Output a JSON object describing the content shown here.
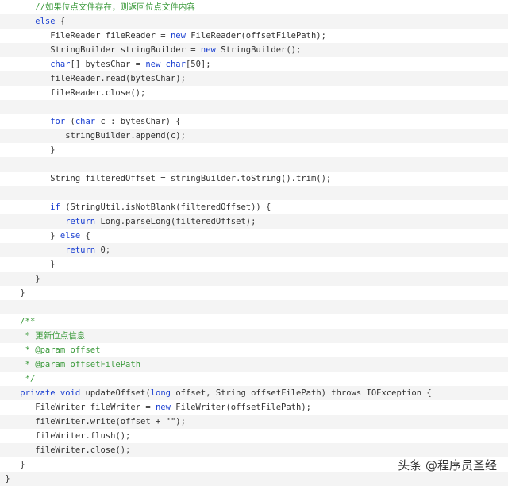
{
  "code": {
    "lines": [
      {
        "indent": 7,
        "tokens": [
          {
            "t": "cm",
            "v": "//如果位点文件存在，则返回位点文件内容"
          }
        ]
      },
      {
        "indent": 7,
        "tokens": [
          {
            "t": "kw",
            "v": "else"
          },
          {
            "t": "tx",
            "v": " {"
          }
        ]
      },
      {
        "indent": 10,
        "tokens": [
          {
            "t": "tx",
            "v": "FileReader fileReader = "
          },
          {
            "t": "kw",
            "v": "new"
          },
          {
            "t": "tx",
            "v": " FileReader(offsetFilePath);"
          }
        ]
      },
      {
        "indent": 10,
        "tokens": [
          {
            "t": "tx",
            "v": "StringBuilder stringBuilder = "
          },
          {
            "t": "kw",
            "v": "new"
          },
          {
            "t": "tx",
            "v": " StringBuilder();"
          }
        ]
      },
      {
        "indent": 10,
        "tokens": [
          {
            "t": "kw",
            "v": "char"
          },
          {
            "t": "tx",
            "v": "[] bytesChar = "
          },
          {
            "t": "kw",
            "v": "new"
          },
          {
            "t": "tx",
            "v": " "
          },
          {
            "t": "kw",
            "v": "char"
          },
          {
            "t": "tx",
            "v": "[50];"
          }
        ]
      },
      {
        "indent": 10,
        "tokens": [
          {
            "t": "tx",
            "v": "fileReader.read(bytesChar);"
          }
        ]
      },
      {
        "indent": 10,
        "tokens": [
          {
            "t": "tx",
            "v": "fileReader.close();"
          }
        ]
      },
      {
        "indent": 0,
        "tokens": []
      },
      {
        "indent": 10,
        "tokens": [
          {
            "t": "kw",
            "v": "for"
          },
          {
            "t": "tx",
            "v": " ("
          },
          {
            "t": "kw",
            "v": "char"
          },
          {
            "t": "tx",
            "v": " c : bytesChar) {"
          }
        ]
      },
      {
        "indent": 13,
        "tokens": [
          {
            "t": "tx",
            "v": "stringBuilder.append(c);"
          }
        ]
      },
      {
        "indent": 10,
        "tokens": [
          {
            "t": "tx",
            "v": "}"
          }
        ]
      },
      {
        "indent": 0,
        "tokens": []
      },
      {
        "indent": 10,
        "tokens": [
          {
            "t": "tx",
            "v": "String filteredOffset = stringBuilder.toString().trim();"
          }
        ]
      },
      {
        "indent": 0,
        "tokens": []
      },
      {
        "indent": 10,
        "tokens": [
          {
            "t": "kw",
            "v": "if"
          },
          {
            "t": "tx",
            "v": " (StringUtil.isNotBlank(filteredOffset)) {"
          }
        ]
      },
      {
        "indent": 13,
        "tokens": [
          {
            "t": "kw",
            "v": "return"
          },
          {
            "t": "tx",
            "v": " Long.parseLong(filteredOffset);"
          }
        ]
      },
      {
        "indent": 10,
        "tokens": [
          {
            "t": "tx",
            "v": "} "
          },
          {
            "t": "kw",
            "v": "else"
          },
          {
            "t": "tx",
            "v": " {"
          }
        ]
      },
      {
        "indent": 13,
        "tokens": [
          {
            "t": "kw",
            "v": "return"
          },
          {
            "t": "tx",
            "v": " 0;"
          }
        ]
      },
      {
        "indent": 10,
        "tokens": [
          {
            "t": "tx",
            "v": "}"
          }
        ]
      },
      {
        "indent": 7,
        "tokens": [
          {
            "t": "tx",
            "v": "}"
          }
        ]
      },
      {
        "indent": 4,
        "tokens": [
          {
            "t": "tx",
            "v": "}"
          }
        ]
      },
      {
        "indent": 0,
        "tokens": []
      },
      {
        "indent": 4,
        "tokens": [
          {
            "t": "cm",
            "v": "/**"
          }
        ]
      },
      {
        "indent": 4,
        "tokens": [
          {
            "t": "cm",
            "v": " * 更新位点信息"
          }
        ]
      },
      {
        "indent": 4,
        "tokens": [
          {
            "t": "cm",
            "v": " * @param offset"
          }
        ]
      },
      {
        "indent": 4,
        "tokens": [
          {
            "t": "cm",
            "v": " * @param offsetFilePath"
          }
        ]
      },
      {
        "indent": 4,
        "tokens": [
          {
            "t": "cm",
            "v": " */"
          }
        ]
      },
      {
        "indent": 4,
        "tokens": [
          {
            "t": "kw",
            "v": "private"
          },
          {
            "t": "tx",
            "v": " "
          },
          {
            "t": "kw",
            "v": "void"
          },
          {
            "t": "tx",
            "v": " updateOffset("
          },
          {
            "t": "kw",
            "v": "long"
          },
          {
            "t": "tx",
            "v": " offset, String offsetFilePath) throws IOException {"
          }
        ]
      },
      {
        "indent": 7,
        "tokens": [
          {
            "t": "tx",
            "v": "FileWriter fileWriter = "
          },
          {
            "t": "kw",
            "v": "new"
          },
          {
            "t": "tx",
            "v": " FileWriter(offsetFilePath);"
          }
        ]
      },
      {
        "indent": 7,
        "tokens": [
          {
            "t": "tx",
            "v": "fileWriter.write(offset + \"\");"
          }
        ]
      },
      {
        "indent": 7,
        "tokens": [
          {
            "t": "tx",
            "v": "fileWriter.flush();"
          }
        ]
      },
      {
        "indent": 7,
        "tokens": [
          {
            "t": "tx",
            "v": "fileWriter.close();"
          }
        ]
      },
      {
        "indent": 4,
        "tokens": [
          {
            "t": "tx",
            "v": "}"
          }
        ]
      },
      {
        "indent": 1,
        "tokens": [
          {
            "t": "tx",
            "v": "}"
          }
        ]
      }
    ]
  },
  "watermark": {
    "text": "头条 @程序员圣经"
  },
  "colors": {
    "keyword": "#1a3fd1",
    "comment": "#3b9a3b",
    "text": "#333333",
    "alt_row": "#f4f4f4"
  }
}
